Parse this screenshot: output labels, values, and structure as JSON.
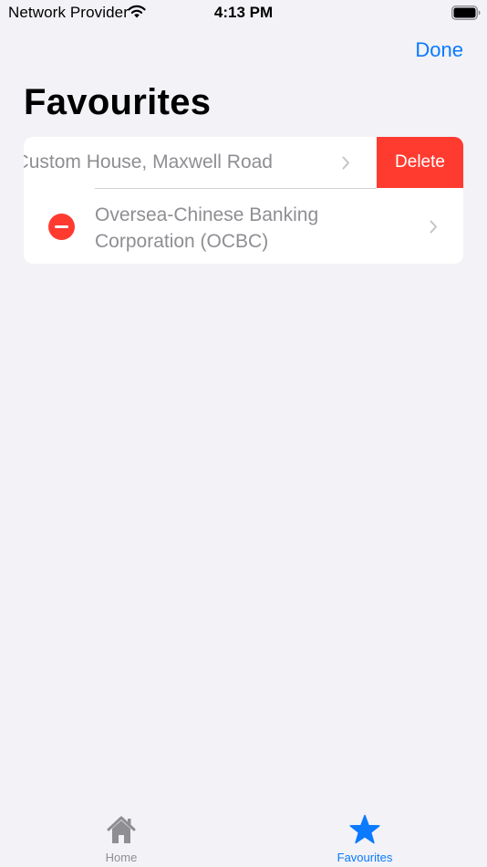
{
  "status_bar": {
    "carrier": "Network Provider",
    "time": "4:13 PM"
  },
  "nav": {
    "done_label": "Done"
  },
  "page": {
    "title": "Favourites"
  },
  "favourites": {
    "items": [
      {
        "label": "Custom House, Maxwell Road",
        "state": "swiped"
      },
      {
        "label": "Oversea-Chinese Banking Corporation (OCBC)",
        "state": "editing"
      }
    ],
    "delete_label": "Delete"
  },
  "tab_bar": {
    "tabs": [
      {
        "label": "Home",
        "icon": "house-icon",
        "active": false
      },
      {
        "label": "Favourites",
        "icon": "star-icon",
        "active": true
      }
    ]
  },
  "colors": {
    "accent": "#0a7aff",
    "destructive": "#ff3b30",
    "background": "#f2f2f7",
    "secondary_text": "#8e8e93"
  }
}
